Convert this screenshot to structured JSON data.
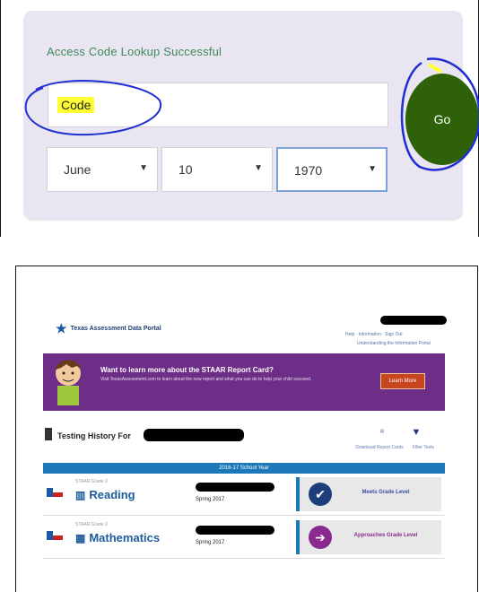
{
  "lookup": {
    "title": "Access Code Lookup Successful",
    "code_value": "Code",
    "month": "June",
    "day": "10",
    "year": "1970",
    "go_label": "Go"
  },
  "colors": {
    "card_bg": "#e9e6f1",
    "title_green": "#3f8a5c",
    "go_green": "#2f6109",
    "highlight": "#ffff33",
    "ink_blue": "#1f2fd1",
    "banner_purple": "#6d2e87",
    "portal_blue": "#1c78b9"
  },
  "portal": {
    "logo": "Texas Assessment Data Portal",
    "header_links": "Help · Information · Sign Out",
    "header_link2": "Understanding the Information Portal",
    "banner_title": "Want to learn more about the STAAR Report Card?",
    "banner_text": "Visit TexasAssessment.com to learn about the new report and what you can do to help your child succeed.",
    "learn_more": "Learn More",
    "testing_history": "Testing History For",
    "download_label": "Download Report Cards",
    "filter_label": "Filter Tests",
    "school_year": "2016-17 School Year",
    "rows": [
      {
        "grade": "STAAR Grade 3",
        "subject": "Reading",
        "term": "Spring 2017",
        "result": "Meets Grade Level",
        "icon": "check-icon",
        "icon_color": "#1d3e7a",
        "text_color": "#3c4fa0"
      },
      {
        "grade": "STAAR Grade 3",
        "subject": "Mathematics",
        "term": "Spring 2017",
        "result": "Approaches Grade Level",
        "icon": "arrow-right-icon",
        "icon_color": "#8a2a8e",
        "text_color": "#8a2a8e"
      }
    ]
  }
}
